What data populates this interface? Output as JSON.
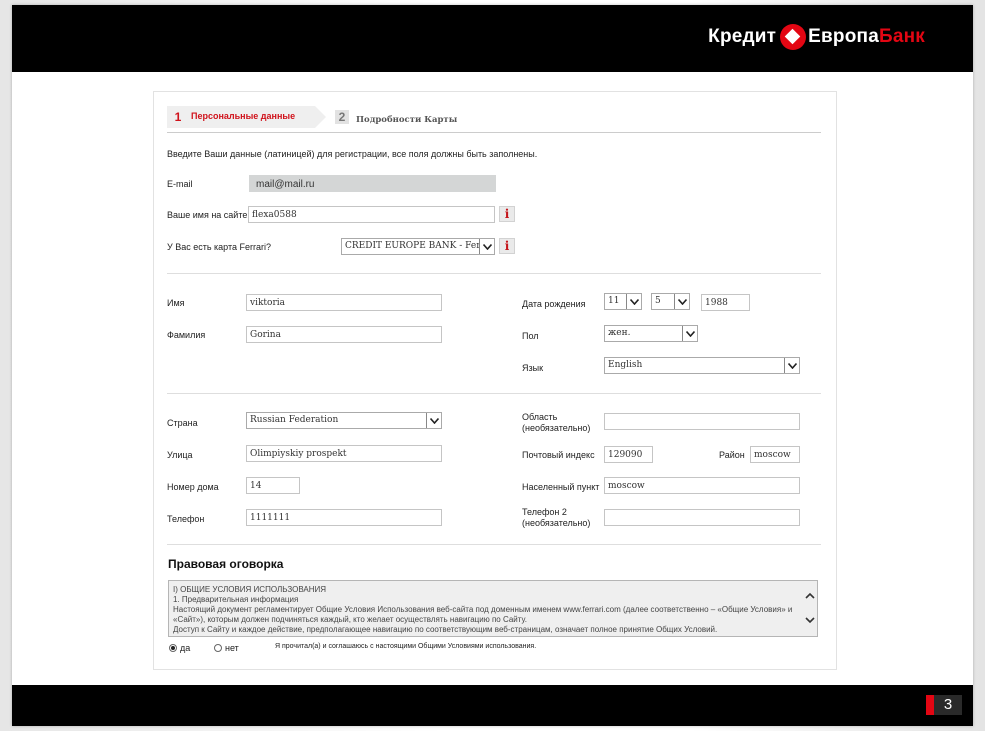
{
  "brand": {
    "part1": "Кредит",
    "part2": "Европа",
    "part3": "Банк"
  },
  "slide": {
    "page_number": "3"
  },
  "steps": [
    {
      "num": "1",
      "label": "Персональные данные"
    },
    {
      "num": "2",
      "label": "Подробности Карты"
    }
  ],
  "form": {
    "intro": "Введите Ваши данные (латиницей) для регистрации, все поля должны быть заполнены.",
    "email": {
      "label": "E-mail",
      "value": "mail@mail.ru"
    },
    "nickname": {
      "label": "Ваше имя на сайте",
      "value": "flexa0588",
      "info": "i"
    },
    "ferrari_card": {
      "label": "У Вас есть карта Ferrari?",
      "value": "CREDIT EUROPE BANK - Ferrari C",
      "info": "i"
    },
    "first_name": {
      "label": "Имя",
      "value": "viktoria"
    },
    "last_name": {
      "label": "Фамилия",
      "value": "Gorina"
    },
    "birth": {
      "label": "Дата рождения",
      "day": "11",
      "month": "5",
      "year": "1988"
    },
    "gender": {
      "label": "Пол",
      "value": "жен."
    },
    "language": {
      "label": "Язык",
      "value": "English"
    },
    "country": {
      "label": "Страна",
      "value": "Russian Federation"
    },
    "region": {
      "label_1": "Область",
      "label_2": "(необязательно)",
      "value": ""
    },
    "street": {
      "label": "Улица",
      "value": "Olimpiyskiy prospekt"
    },
    "postal": {
      "label": "Почтовый индекс",
      "value": "129090"
    },
    "district": {
      "label": "Район",
      "value": "moscow"
    },
    "house": {
      "label": "Номер дома",
      "value": "14"
    },
    "city": {
      "label": "Населенный пункт",
      "value": "moscow"
    },
    "phone": {
      "label": "Телефон",
      "value": "1111111"
    },
    "phone2": {
      "label_1": "Телефон 2",
      "label_2": "(необязательно)",
      "value": ""
    }
  },
  "legal": {
    "title": "Правовая оговорка",
    "line1": "I) ОБЩИЕ УСЛОВИЯ ИСПОЛЬЗОВАНИЯ",
    "line2": "1. Предварительная информация",
    "line3": "Настоящий документ регламентирует Общие Условия Использования веб-сайта под доменным именем www.ferrari.com (далее соответственно – «Общие Условия» и «Сайт»), которым должен подчиняться каждый, кто желает осуществлять навигацию по Сайту.",
    "line4": "Доступ к Сайту и каждое действие, предполагающее навигацию по соответствующим веб-страницам, означает полное принятие Общих Условий.",
    "yes": "да",
    "no": "нет",
    "agree_text": "Я прочитал(а) и соглашаюсь с настоящими Общими Условиями использования."
  }
}
